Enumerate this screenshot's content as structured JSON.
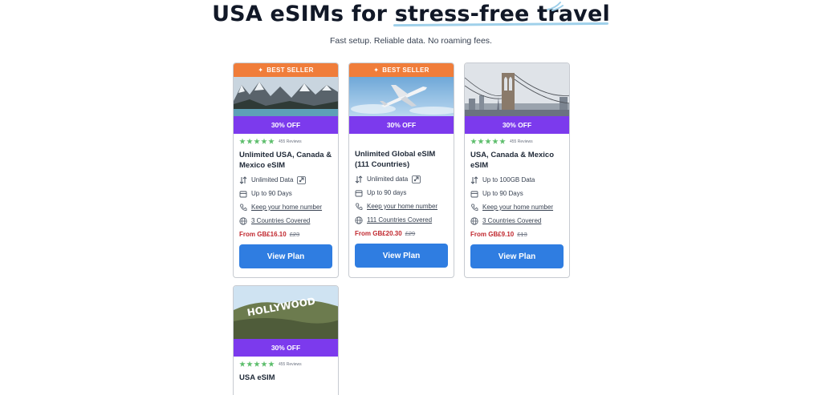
{
  "hero": {
    "title_plain": "USA eSIMs for ",
    "title_accent": "stress-free travel",
    "subtitle": "Fast setup. Reliable data. No roaming fees."
  },
  "colors": {
    "best_seller": "#f07d3a",
    "discount_bar": "#7c3aed",
    "stars": "#5cbd6b",
    "price_red": "#c0262d",
    "button": "#2f7de1"
  },
  "cards": [
    {
      "badge": "BEST SELLER",
      "image": "mountain-lake-photo",
      "discount": "30% OFF",
      "reviews": "455 Reviews",
      "stars": 5,
      "title": "Unlimited USA, Canada & Mexico eSIM",
      "data": "Unlimited Data",
      "validity": "Up to 90 Days",
      "home_number": "Keep your home number",
      "coverage": "3 Countries Covered",
      "price_from": "From GB£16.10",
      "price_old": "£23",
      "button": "View Plan"
    },
    {
      "badge": "BEST SELLER",
      "image": "airplane-sky-photo",
      "discount": "30% OFF",
      "reviews": "",
      "stars": 0,
      "title": "Unlimited Global eSIM (111 Countries)",
      "data": "Unlimited data",
      "validity": "Up to 90 days",
      "home_number": "Keep your home number",
      "coverage": "111 Countries Covered",
      "price_from": "From GB£20.30",
      "price_old": "£29",
      "button": "View Plan"
    },
    {
      "badge": "",
      "image": "brooklyn-bridge-photo",
      "discount": "30% OFF",
      "reviews": "455 Reviews",
      "stars": 5,
      "title": "USA, Canada & Mexico eSIM",
      "data": "Up to 100GB Data",
      "validity": "Up to 90 Days",
      "home_number": "Keep your home number",
      "coverage": "3 Countries Covered",
      "price_from": "From GB£9.10",
      "price_old": "£13",
      "button": "View Plan"
    },
    {
      "badge": "",
      "image": "hollywood-sign-photo",
      "sign_text": "HOLLYWOOD",
      "discount": "30% OFF",
      "reviews": "455 Reviews",
      "stars": 5,
      "title": "USA eSIM"
    }
  ]
}
